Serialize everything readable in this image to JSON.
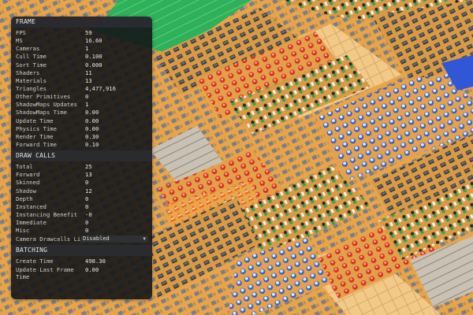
{
  "stats": {
    "frame": {
      "title": "FRAME",
      "rows": [
        {
          "label": "FPS",
          "value": "59"
        },
        {
          "label": "MS",
          "value": "16.60"
        },
        {
          "label": "Cameras",
          "value": "1"
        },
        {
          "label": "Cull Time",
          "value": "0.100"
        },
        {
          "label": "Sort Time",
          "value": "0.000"
        },
        {
          "label": "Shaders",
          "value": "11"
        },
        {
          "label": "Materials",
          "value": "13"
        },
        {
          "label": "Triangles",
          "value": "4,477,916"
        },
        {
          "label": "Other Primitives",
          "value": "0"
        },
        {
          "label": "ShadowMaps Updates",
          "value": "1"
        },
        {
          "label": "ShadowMaps Time",
          "value": "0.00"
        },
        {
          "label": "Update Time",
          "value": "0.00"
        },
        {
          "label": "Physics Time",
          "value": "0.00"
        },
        {
          "label": "Render Time",
          "value": "0.30"
        },
        {
          "label": "Forward Time",
          "value": "0.10"
        }
      ]
    },
    "draw_calls": {
      "title": "DRAW CALLS",
      "rows": [
        {
          "label": "Total",
          "value": "25"
        },
        {
          "label": "Forward",
          "value": "13"
        },
        {
          "label": "Skinned",
          "value": "0"
        },
        {
          "label": "Shadow",
          "value": "12"
        },
        {
          "label": "Depth",
          "value": "0"
        },
        {
          "label": "Instanced",
          "value": "0"
        },
        {
          "label": "Instancing Benefit",
          "value": "-0"
        },
        {
          "label": "Immediate",
          "value": "0"
        },
        {
          "label": "Misc",
          "value": "0"
        }
      ],
      "camera_limit_label": "Camera Drawcalls Limit",
      "camera_limit_value": "Disabled"
    },
    "batching": {
      "title": "BATCHING",
      "rows": [
        {
          "label": "Create Time",
          "value": "498.30"
        },
        {
          "label": "Update Last Frame Time",
          "value": "0.00"
        }
      ]
    }
  },
  "colors": {
    "panel_bg": "#141618",
    "scene_floor": "#e9a64a",
    "grass": "#2fb05a",
    "sand": "#f2c987",
    "stone": "#c9c1b3"
  },
  "icons": {
    "dropdown": "chevron-down-icon"
  }
}
